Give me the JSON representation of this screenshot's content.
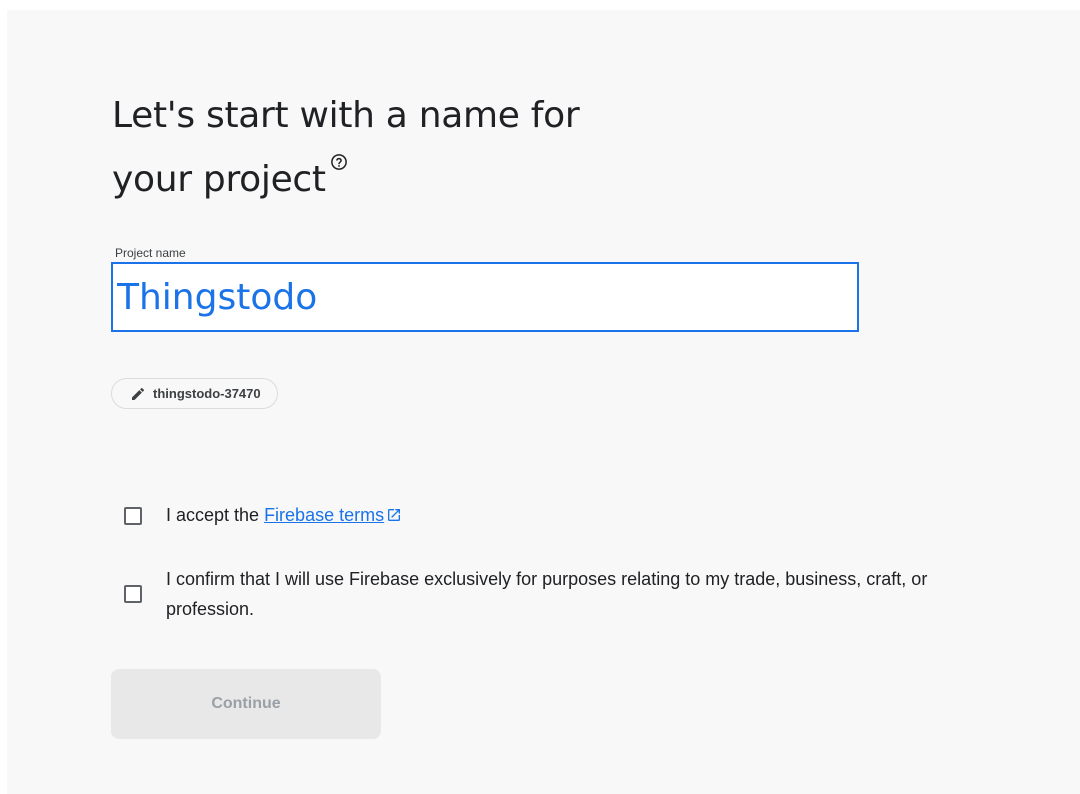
{
  "heading": {
    "line1": "Let's start with a name for",
    "line2": "your project",
    "help_icon": "help-circle-icon"
  },
  "project_name": {
    "label": "Project name",
    "value": "Thingstodo"
  },
  "project_id_chip": {
    "icon": "pencil-icon",
    "value": "thingstodo-37470"
  },
  "terms": {
    "prefix": "I accept the ",
    "link_text": "Firebase terms",
    "link_icon": "external-link-icon",
    "checked": false
  },
  "confirm": {
    "text": "I confirm that I will use Firebase exclusively for purposes relating to my trade, business, craft, or profession.",
    "checked": false
  },
  "continue_button": {
    "label": "Continue",
    "enabled": false
  },
  "colors": {
    "accent": "#1a73e8",
    "background": "#f8f8f8",
    "disabled_button": "#e8e8e8"
  }
}
